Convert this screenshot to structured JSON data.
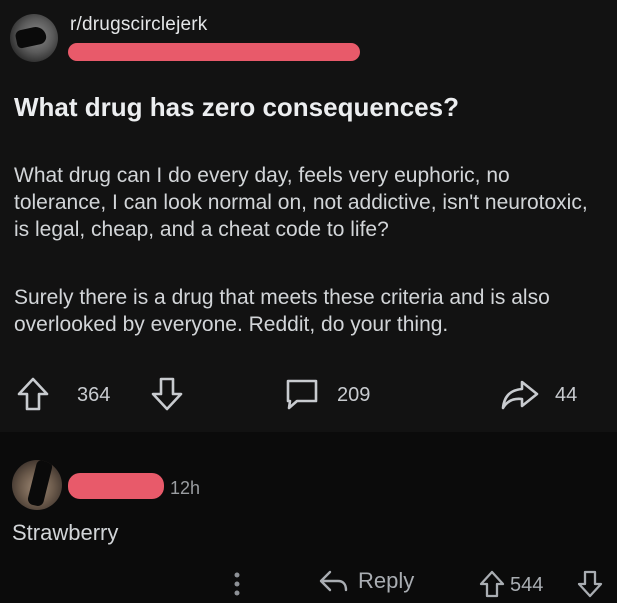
{
  "post": {
    "subreddit": "r/drugscirclejerk",
    "title": "What drug has zero consequences?",
    "body": [
      "What drug can I do every day, feels very euphoric, no tolerance, I can look normal on, not addictive, isn't neurotoxic, is legal, cheap, and a cheat code to life?",
      "Surely there is a drug that meets these criteria and is also overlooked by everyone. Reddit, do your thing."
    ],
    "upvotes": "364",
    "comments": "209",
    "shares": "44"
  },
  "comment": {
    "time": "12h",
    "text": "Strawberry",
    "reply_label": "Reply",
    "score": "544"
  },
  "colors": {
    "background": "#0b0b0b",
    "post_background": "#121212",
    "redaction": "#e85a6a",
    "text": "#d7dadc",
    "muted": "#9a9da1"
  },
  "icons": [
    "upvote-icon",
    "downvote-icon",
    "comment-icon",
    "share-icon",
    "more-icon",
    "reply-icon"
  ]
}
